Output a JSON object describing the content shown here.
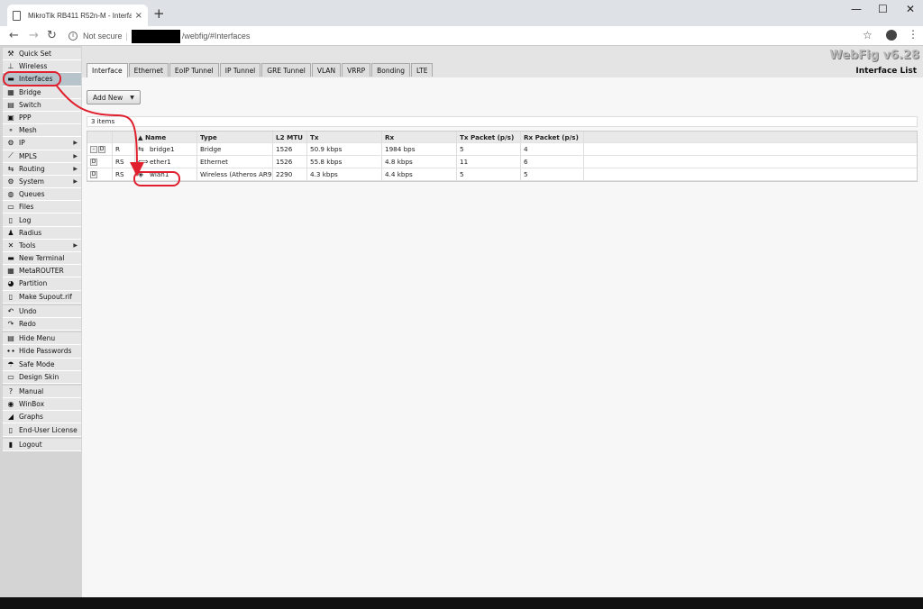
{
  "browser": {
    "tab_title": "MikroTik RB411 R52n-M - Interfa",
    "tab_close": "×",
    "new_tab": "+",
    "minimize": "—",
    "maximize": "☐",
    "close": "✕",
    "security_label": "Not secure",
    "url_path": "/webfig/#Interfaces",
    "back": "←",
    "forward": "→",
    "reload": "↻"
  },
  "brand": "WebFig v6.28",
  "page_title": "Interface List",
  "sidebar": {
    "items": [
      {
        "label": "Quick Set",
        "icon": "⚒"
      },
      {
        "label": "Wireless",
        "icon": "⊥"
      },
      {
        "label": "Interfaces",
        "icon": "▬"
      },
      {
        "label": "Bridge",
        "icon": "▦"
      },
      {
        "label": "Switch",
        "icon": "▤"
      },
      {
        "label": "PPP",
        "icon": "▣"
      },
      {
        "label": "Mesh",
        "icon": "⚬"
      },
      {
        "label": "IP",
        "icon": "⚙"
      },
      {
        "label": "MPLS",
        "icon": "⟋"
      },
      {
        "label": "Routing",
        "icon": "⇆"
      },
      {
        "label": "System",
        "icon": "⚙"
      },
      {
        "label": "Queues",
        "icon": "◍"
      },
      {
        "label": "Files",
        "icon": "▭"
      },
      {
        "label": "Log",
        "icon": "▯"
      },
      {
        "label": "Radius",
        "icon": "♟"
      },
      {
        "label": "Tools",
        "icon": "✕"
      },
      {
        "label": "New Terminal",
        "icon": "▬"
      },
      {
        "label": "MetaROUTER",
        "icon": "▦"
      },
      {
        "label": "Partition",
        "icon": "◕"
      },
      {
        "label": "Make Supout.rif",
        "icon": "▯"
      },
      {
        "label": "Undo",
        "icon": "↶"
      },
      {
        "label": "Redo",
        "icon": "↷"
      },
      {
        "label": "Hide Menu",
        "icon": "▤"
      },
      {
        "label": "Hide Passwords",
        "icon": "∙∙"
      },
      {
        "label": "Safe Mode",
        "icon": "☂"
      },
      {
        "label": "Design Skin",
        "icon": "▭"
      },
      {
        "label": "Manual",
        "icon": "?"
      },
      {
        "label": "WinBox",
        "icon": "◉"
      },
      {
        "label": "Graphs",
        "icon": "◢"
      },
      {
        "label": "End-User License",
        "icon": "▯"
      },
      {
        "label": "Logout",
        "icon": "▮"
      }
    ],
    "submenu_arrow": "▶"
  },
  "tabs": [
    "Interface",
    "Ethernet",
    "EoIP Tunnel",
    "IP Tunnel",
    "GRE Tunnel",
    "VLAN",
    "VRRP",
    "Bonding",
    "LTE"
  ],
  "toolbar": {
    "add_new": "Add New",
    "dropdown": "▼"
  },
  "item_count": "3 items",
  "table": {
    "headers": [
      "",
      "",
      "▲ Name",
      "Type",
      "L2 MTU",
      "Tx",
      "Rx",
      "Tx Packet (p/s)",
      "Rx Packet (p/s)"
    ],
    "rows": [
      {
        "btn_minus": "-",
        "btn_d": "D",
        "flags": "R",
        "icon": "⇆",
        "name": "bridge1",
        "type": "Bridge",
        "l2mtu": "1526",
        "tx": "50.9 kbps",
        "rx": "1984 bps",
        "txp": "5",
        "rxp": "4"
      },
      {
        "btn_minus": "",
        "btn_d": "D",
        "flags": "RS",
        "icon": "⟺",
        "name": "ether1",
        "type": "Ethernet",
        "l2mtu": "1526",
        "tx": "55.8 kbps",
        "rx": "4.8 kbps",
        "txp": "11",
        "rxp": "6"
      },
      {
        "btn_minus": "",
        "btn_d": "D",
        "flags": "RS",
        "icon": "◈",
        "name": "wlan1",
        "type": "Wireless (Atheros AR9",
        "l2mtu": "2290",
        "tx": "4.3 kbps",
        "rx": "4.4 kbps",
        "txp": "5",
        "rxp": "5"
      }
    ]
  },
  "colors": {
    "annotation_red": "#e0202e",
    "active_menu": "#b8c4cc"
  }
}
